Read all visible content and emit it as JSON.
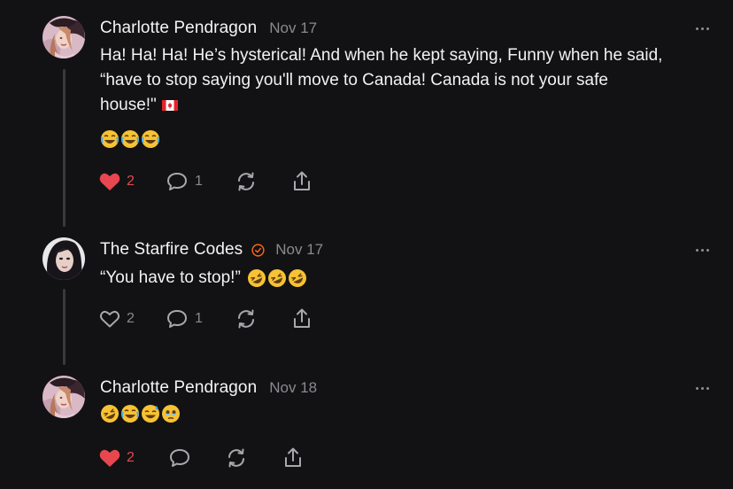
{
  "colors": {
    "background": "#121214",
    "text": "#f2f2f2",
    "muted": "#8a8a8e",
    "like_red": "#e8474f",
    "verified_orange": "#ff6719",
    "thread_line": "#3a3a3d"
  },
  "comments": [
    {
      "author": "Charlotte Pendragon",
      "date": "Nov 17",
      "verified": false,
      "text_lines": [
        "Ha! Ha! Ha! He’s hysterical! And when he kept saying, Funny when he said,",
        "“have to stop saying you'll move to Canada! Canada is not your safe",
        "house!\""
      ],
      "inline_flag": "canada-flag",
      "emoji_line": [
        "joy",
        "joy",
        "joy"
      ],
      "likes": "2",
      "liked": true,
      "replies": "1",
      "icons": [
        "heart-icon",
        "comment-icon",
        "restack-icon",
        "share-icon",
        "more-icon"
      ]
    },
    {
      "author": "The Starfire Codes",
      "date": "Nov 17",
      "verified": true,
      "text_lines": [
        "“You have to stop!”"
      ],
      "inline_emojis": [
        "rofl",
        "rofl",
        "rofl"
      ],
      "likes": "2",
      "liked": false,
      "replies": "1",
      "icons": [
        "heart-outline-icon",
        "comment-icon",
        "restack-icon",
        "share-icon",
        "more-icon",
        "verified-icon"
      ]
    },
    {
      "author": "Charlotte Pendragon",
      "date": "Nov 18",
      "verified": false,
      "text_lines": [],
      "emoji_line": [
        "rofl",
        "joy",
        "sweat-smile",
        "holding-back-tears"
      ],
      "likes": "2",
      "liked": true,
      "replies": "",
      "icons": [
        "heart-icon",
        "comment-icon",
        "restack-icon",
        "share-icon",
        "more-icon"
      ]
    }
  ]
}
